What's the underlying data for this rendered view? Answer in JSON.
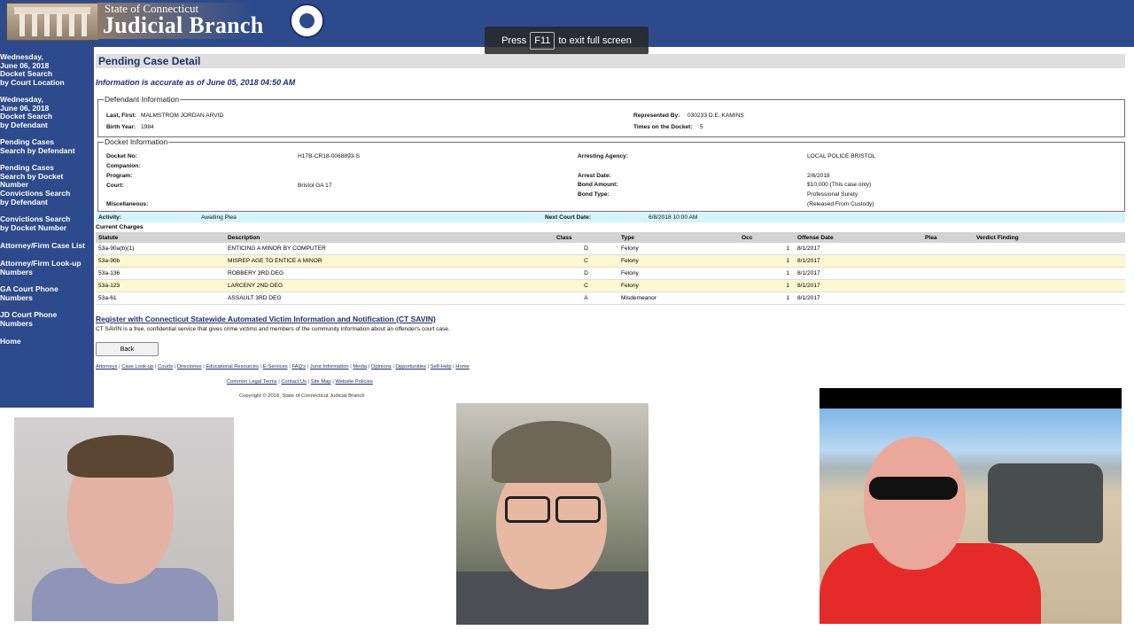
{
  "header": {
    "logo_small": "State of Connecticut",
    "logo_big": "Judicial Branch"
  },
  "fullscreen_toast": {
    "press": "Press",
    "key": "F11",
    "suffix": "to exit full screen"
  },
  "sidebar": {
    "items": [
      {
        "lines": [
          "Wednesday,",
          "June 06, 2018",
          "Docket Search",
          "by Court Location"
        ]
      },
      {
        "lines": [
          "Wednesday,",
          "June 06, 2018",
          "Docket Search",
          "by Defendant"
        ]
      },
      {
        "lines": [
          "Pending Cases",
          "Search by Defendant"
        ]
      },
      {
        "lines": [
          "Pending Cases",
          "Search by Docket Number"
        ]
      },
      {
        "lines": [
          "Convictions Search",
          "by Defendant"
        ]
      },
      {
        "lines": [
          "Convictions Search",
          "by Docket Number"
        ]
      },
      {
        "lines": [
          "Attorney/Firm Case List"
        ]
      },
      {
        "lines": [
          "Attorney/Firm Look-up",
          "Numbers"
        ]
      },
      {
        "lines": [
          "GA Court Phone",
          "Numbers"
        ]
      },
      {
        "lines": [
          "JD Court Phone",
          "Numbers"
        ]
      },
      {
        "lines": [
          "Home"
        ]
      }
    ]
  },
  "page": {
    "title": "Pending Case Detail",
    "accuracy": "Information is accurate as of June 05, 2018 04:50 AM"
  },
  "defendant": {
    "legend": "Defendant Information",
    "name_label": "Last, First:",
    "name": "MALMSTROM JORDAN ARVID",
    "birth_label": "Birth Year:",
    "birth": "1984",
    "rep_label": "Represented By:",
    "rep": "030233 D.E. KAMINS",
    "times_label": "Times on the Docket:",
    "times": "5"
  },
  "docket": {
    "legend": "Docket Information",
    "docket_no_label": "Docket No:",
    "docket_no": "H17B-CR18-0068893-S",
    "companion_label": "Companion:",
    "program_label": "Program:",
    "court_label": "Court:",
    "court": "Bristol GA 17",
    "misc_label": "Miscellaneous:",
    "agency_label": "Arresting Agency:",
    "agency": "LOCAL POLICE BRISTOL",
    "arrest_label": "Arrest Date:",
    "arrest": "2/6/2018",
    "bond_amount_label": "Bond Amount:",
    "bond_amount": "$10,000 (This case only)",
    "bond_type_label": "Bond Type:",
    "bond_type": "Professional Surety",
    "bond_type_note": "(Released From Custody)"
  },
  "activity": {
    "label": "Activity:",
    "value": "Awaiting Plea",
    "next_label": "Next Court Date:",
    "next_value": "6/8/2018 10:00 AM"
  },
  "charges": {
    "label": "Current Charges",
    "headers": [
      "Statute",
      "Description",
      "Class",
      "Type",
      "Occ",
      "Offense Date",
      "Plea",
      "Verdict Finding"
    ],
    "rows": [
      [
        "53a-90a(b)(1)",
        "ENTICING A MINOR BY COMPUTER",
        "D",
        "Felony",
        "1",
        "8/1/2017",
        "",
        ""
      ],
      [
        "53a-90b",
        "MISREP AGE TO ENTICE A MINOR",
        "C",
        "Felony",
        "1",
        "8/1/2017",
        "",
        ""
      ],
      [
        "53a-136",
        "ROBBERY 3RD DEG",
        "D",
        "Felony",
        "1",
        "8/1/2017",
        "",
        ""
      ],
      [
        "53a-123",
        "LARCENY 2ND DEG",
        "C",
        "Felony",
        "1",
        "8/1/2017",
        "",
        ""
      ],
      [
        "53a-61",
        "ASSAULT 3RD DEG",
        "A",
        "Misdemeanor",
        "1",
        "8/1/2017",
        "",
        ""
      ]
    ]
  },
  "savin": {
    "link": "Register with Connecticut Statewide Automated Victim Information and Notification (CT SAVIN)",
    "text": "CT SAVIN is a free, confidential service that gives crime victims and members of the community information about an offender's court case."
  },
  "back_label": "Back",
  "footer": {
    "links1": [
      "Attorneys",
      "Case Look-up",
      "Courts",
      "Directories",
      "Educational Resources",
      "E-Services",
      "FAQ's",
      "Juror Information",
      "Media",
      "Opinions",
      "Opportunities",
      "Self-Help",
      "Home"
    ],
    "links2": [
      "Common Legal Terms",
      "Contact Us",
      "Site Map",
      "Website Policies"
    ],
    "copyright": "Copyright © 2018, State of Connecticut Judicial Branch"
  },
  "colors": {
    "nav_blue": "#2d4a8c",
    "title_blue": "#1a3170",
    "activity_bg": "#d4f5fb",
    "alt_row": "#fdf7d2"
  }
}
